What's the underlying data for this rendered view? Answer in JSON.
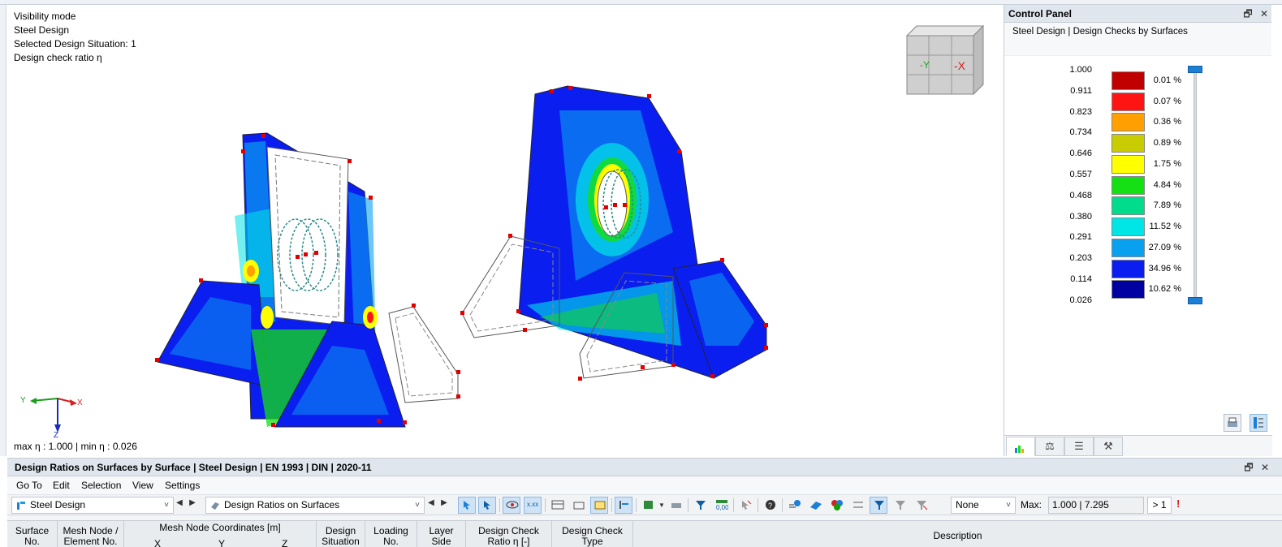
{
  "viewport": {
    "info_lines": [
      "Visibility mode",
      "Steel Design",
      "Selected Design Situation: 1",
      "Design check ratio η"
    ],
    "max_min": "max η : 1.000 | min η : 0.026",
    "axes": {
      "y": "Y",
      "x": "X",
      "z": "Z"
    },
    "nav_cube": {
      "face_left": "-Y",
      "face_right": "-X"
    }
  },
  "control_panel": {
    "title": "Control Panel",
    "subtitle": "Steel Design | Design Checks by Surfaces",
    "legend_values": [
      "1.000",
      "0.911",
      "0.823",
      "0.734",
      "0.646",
      "0.557",
      "0.468",
      "0.380",
      "0.291",
      "0.203",
      "0.114",
      "0.026"
    ],
    "legend_bins": [
      {
        "color": "#c00000",
        "percent": "0.01 %"
      },
      {
        "color": "#ff1414",
        "percent": "0.07 %"
      },
      {
        "color": "#ff9f00",
        "percent": "0.36 %"
      },
      {
        "color": "#c8cc00",
        "percent": "0.89 %"
      },
      {
        "color": "#ffff00",
        "percent": "1.75 %"
      },
      {
        "color": "#14e014",
        "percent": "4.84 %"
      },
      {
        "color": "#00dc8c",
        "percent": "7.89 %"
      },
      {
        "color": "#00e6e6",
        "percent": "11.52 %"
      },
      {
        "color": "#0aa0f0",
        "percent": "27.09 %"
      },
      {
        "color": "#0a1ef0",
        "percent": "34.96 %"
      },
      {
        "color": "#0000a0",
        "percent": "10.62 %"
      }
    ],
    "tabs": [
      "legend-icon",
      "balance-icon",
      "list-icon",
      "settings-icon"
    ]
  },
  "bottom_panel": {
    "title": "Design Ratios on Surfaces by Surface | Steel Design | EN 1993 | DIN | 2020-11",
    "menu": [
      "Go To",
      "Edit",
      "Selection",
      "View",
      "Settings"
    ],
    "module_select": "Steel Design",
    "result_select": "Design Ratios on Surfaces",
    "filter_select": "None",
    "max_label": "Max:",
    "max_value": "1.000 | 7.295",
    "gt_value": "> 1",
    "columns": [
      {
        "line1": "Surface",
        "line2": "No."
      },
      {
        "line1": "Mesh Node /",
        "line2": "Element No."
      },
      {
        "line1": "Mesh Node Coordinates [m]",
        "sub": [
          "X",
          "Y",
          "Z"
        ]
      },
      {
        "line1": "Design",
        "line2": "Situation"
      },
      {
        "line1": "Loading",
        "line2": "No."
      },
      {
        "line1": "Layer",
        "line2": "Side"
      },
      {
        "line1": "Design Check",
        "line2": "Ratio η [-]"
      },
      {
        "line1": "Design Check",
        "line2": "Type"
      },
      {
        "line1": "Description",
        "line2": ""
      }
    ]
  }
}
